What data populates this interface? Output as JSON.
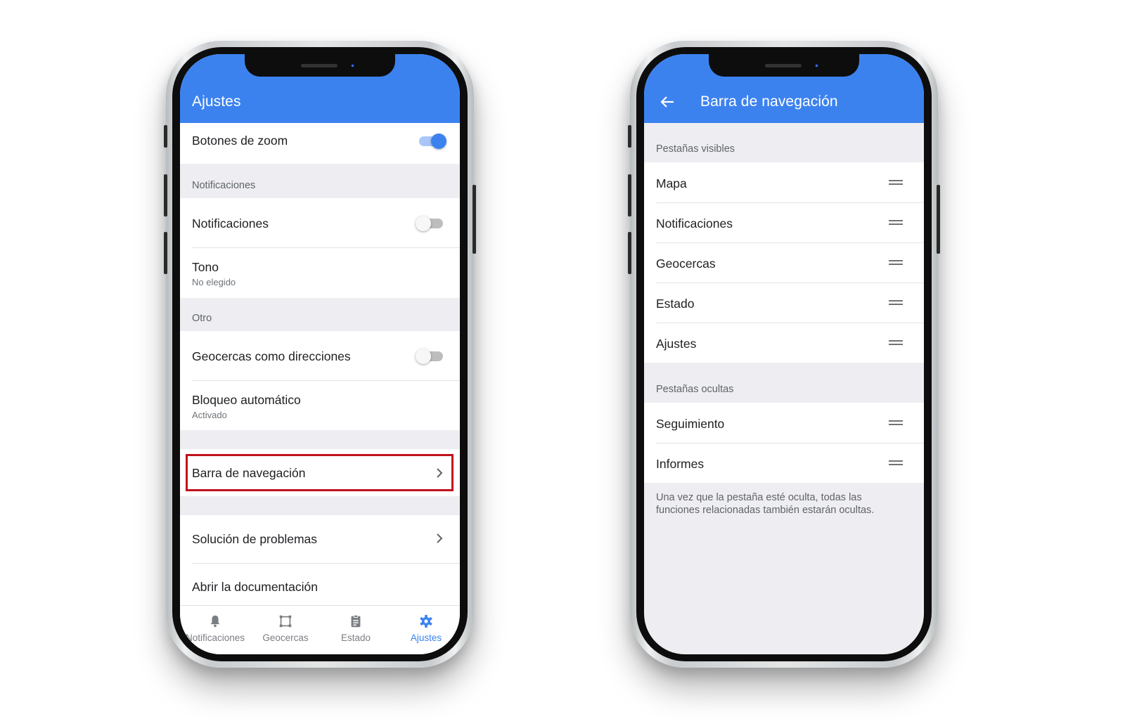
{
  "left_phone": {
    "title": "Ajustes",
    "rows": {
      "zoom_buttons": {
        "label": "Botones de zoom",
        "toggle": "on"
      },
      "section_notifications": "Notificaciones",
      "notifications": {
        "label": "Notificaciones",
        "toggle": "off"
      },
      "tone": {
        "label": "Tono",
        "sub": "No elegido"
      },
      "section_other": "Otro",
      "geofences_as_addresses": {
        "label": "Geocercas como direcciones",
        "toggle": "off"
      },
      "auto_lock": {
        "label": "Bloqueo automático",
        "sub": "Activado"
      },
      "navigation_bar": {
        "label": "Barra de navegación"
      },
      "troubleshooting": {
        "label": "Solución de problemas"
      },
      "open_docs": {
        "label": "Abrir la documentación"
      }
    },
    "tabbar": [
      {
        "label": "Notificaciones",
        "icon": "bell-icon",
        "active": false
      },
      {
        "label": "Geocercas",
        "icon": "geofence-icon",
        "active": false
      },
      {
        "label": "Estado",
        "icon": "clipboard-icon",
        "active": false
      },
      {
        "label": "Ajustes",
        "icon": "gear-icon",
        "active": true
      }
    ]
  },
  "right_phone": {
    "title": "Barra de navegación",
    "visible_header": "Pestañas visibles",
    "visible_tabs": [
      "Mapa",
      "Notificaciones",
      "Geocercas",
      "Estado",
      "Ajustes"
    ],
    "hidden_header": "Pestañas ocultas",
    "hidden_tabs": [
      "Seguimiento",
      "Informes"
    ],
    "note": "Una vez que la pestaña esté oculta, todas las funciones relacionadas también estarán ocultas."
  },
  "colors": {
    "accent": "#3c82ef",
    "highlight_border": "#c0111f",
    "background": "#eeeef2"
  }
}
